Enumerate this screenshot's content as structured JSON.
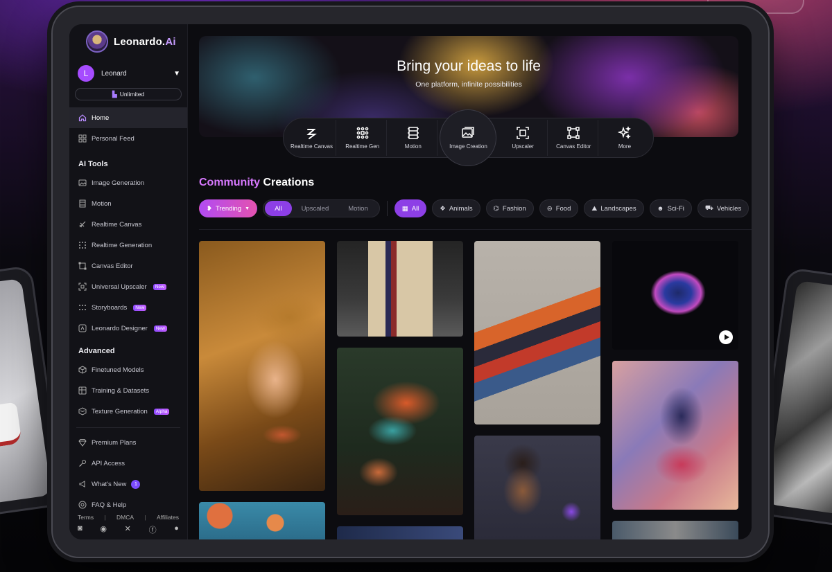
{
  "brand": {
    "name": "Leonardo.",
    "suffix": "Ai"
  },
  "user": {
    "initial": "L",
    "name": "Leonard",
    "plan": "Unlimited"
  },
  "nav_main": [
    {
      "label": "Home",
      "icon": "home-icon",
      "active": true
    },
    {
      "label": "Personal Feed",
      "icon": "grid-icon"
    }
  ],
  "ai_tools": {
    "title": "AI Tools",
    "items": [
      {
        "label": "Image Generation",
        "icon": "image-icon"
      },
      {
        "label": "Motion",
        "icon": "film-icon"
      },
      {
        "label": "Realtime Canvas",
        "icon": "brush-icon"
      },
      {
        "label": "Realtime Generation",
        "icon": "sparkle-grid-icon"
      },
      {
        "label": "Canvas Editor",
        "icon": "canvas-icon"
      },
      {
        "label": "Universal Upscaler",
        "icon": "upscale-icon",
        "badge": "New"
      },
      {
        "label": "Storyboards",
        "icon": "storyboard-icon",
        "badge": "New"
      },
      {
        "label": "Leonardo Designer",
        "icon": "designer-icon",
        "badge": "New"
      }
    ]
  },
  "advanced": {
    "title": "Advanced",
    "items": [
      {
        "label": "Finetuned Models",
        "icon": "cube-icon"
      },
      {
        "label": "Training & Datasets",
        "icon": "dataset-icon"
      },
      {
        "label": "Texture Generation",
        "icon": "texture-icon",
        "badge": "Alpha"
      }
    ]
  },
  "bottom_nav": [
    {
      "label": "Premium Plans",
      "icon": "diamond-icon"
    },
    {
      "label": "API Access",
      "icon": "key-icon"
    },
    {
      "label": "What's New",
      "icon": "megaphone-icon",
      "count": "1"
    },
    {
      "label": "FAQ & Help",
      "icon": "help-icon"
    }
  ],
  "footer": {
    "terms": "Terms",
    "dmca": "DMCA",
    "affiliates": "Affiliates",
    "sep": "|"
  },
  "social_icons": [
    "discord-icon",
    "reddit-icon",
    "x-icon",
    "facebook-icon",
    "apple-icon"
  ],
  "hero": {
    "title": "Bring your ideas to life",
    "subtitle": "One platform, infinite possibilities"
  },
  "tools": [
    {
      "label": "Realtime Canvas",
      "icon": "brush-icon"
    },
    {
      "label": "Realtime Gen",
      "icon": "sparkle-grid-icon"
    },
    {
      "label": "Motion",
      "icon": "film-icon"
    },
    {
      "label": "Image Creation",
      "icon": "image-icon",
      "featured": true
    },
    {
      "label": "Upscaler",
      "icon": "upscale-icon"
    },
    {
      "label": "Canvas Editor",
      "icon": "canvas-icon"
    },
    {
      "label": "More",
      "icon": "sparkles-icon"
    }
  ],
  "community": {
    "title_accent": "Community",
    "title_rest": "Creations"
  },
  "filters": {
    "sort": "Trending",
    "type_options": [
      "All",
      "Upscaled",
      "Motion"
    ],
    "categories": [
      {
        "label": "All",
        "icon": "grid-icon",
        "active": true
      },
      {
        "label": "Animals",
        "icon": "paw-icon"
      },
      {
        "label": "Fashion",
        "icon": "hanger-icon"
      },
      {
        "label": "Food",
        "icon": "food-icon"
      },
      {
        "label": "Landscapes",
        "icon": "landscape-icon"
      },
      {
        "label": "Sci-Fi",
        "icon": "alien-icon"
      },
      {
        "label": "Vehicles",
        "icon": "car-icon"
      }
    ]
  },
  "colors": {
    "accent": "#8d3fe6",
    "accent_pink": "#e352b0",
    "community_accent": "#d879ff"
  }
}
